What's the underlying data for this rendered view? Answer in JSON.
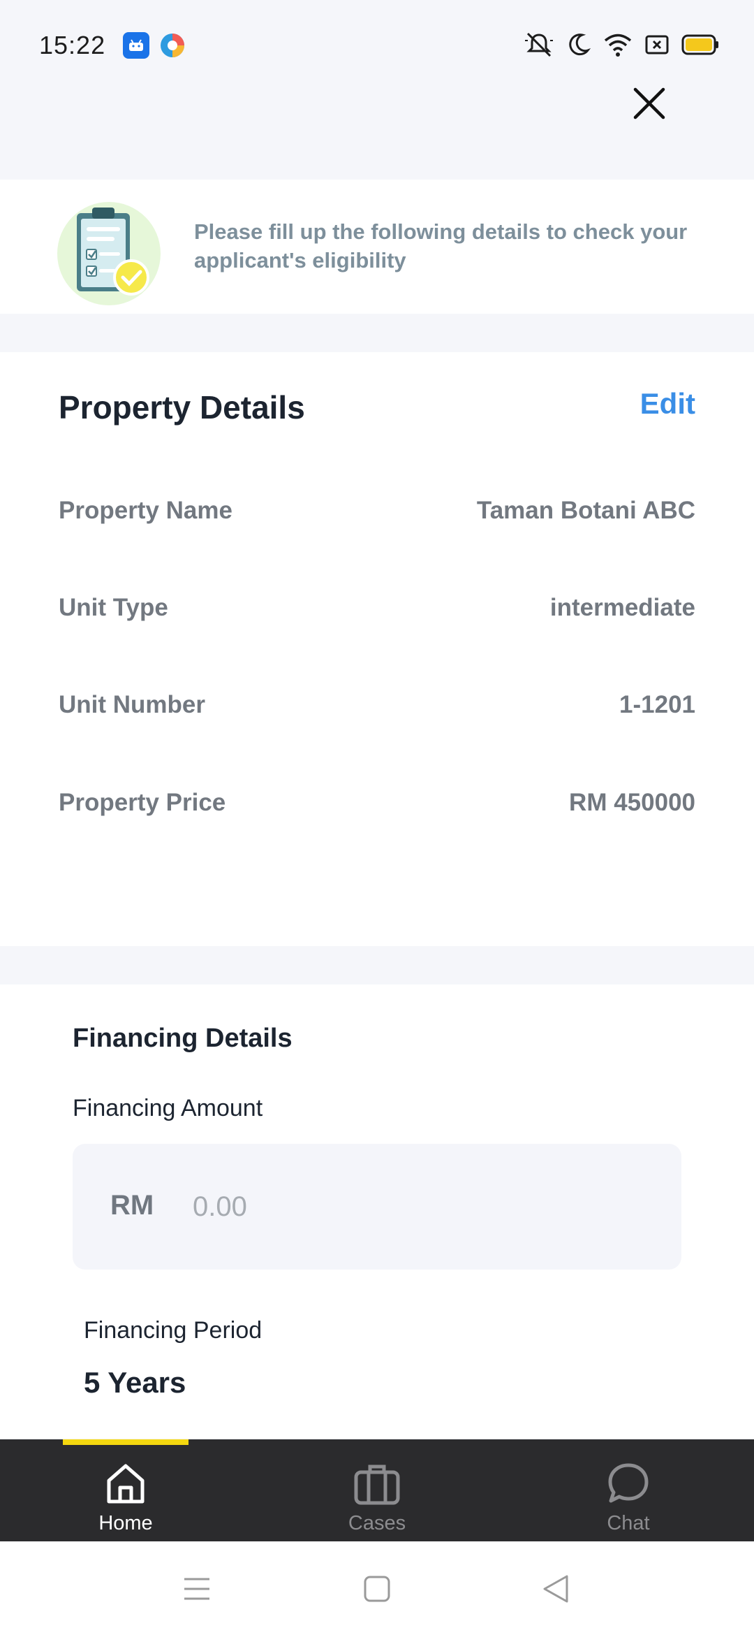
{
  "status_bar": {
    "time": "15:22"
  },
  "banner": {
    "text": "Please fill up the following details to check your applicant's eligibility"
  },
  "property_details": {
    "title": "Property Details",
    "edit_label": "Edit",
    "rows": [
      {
        "label": "Property Name",
        "value": "Taman Botani ABC"
      },
      {
        "label": "Unit Type",
        "value": "intermediate"
      },
      {
        "label": "Unit Number",
        "value": "1-1201"
      },
      {
        "label": "Property Price",
        "value": "RM 450000"
      }
    ]
  },
  "financing_details": {
    "title": "Financing Details",
    "amount_label": "Financing Amount",
    "amount_prefix": "RM",
    "amount_value": "",
    "amount_placeholder": "0.00",
    "period_label": "Financing Period",
    "period_value": "5 Years"
  },
  "tabs": [
    {
      "label": "Home",
      "icon": "home-icon",
      "active": true
    },
    {
      "label": "Cases",
      "icon": "briefcase-icon",
      "active": false
    },
    {
      "label": "Chat",
      "icon": "chat-bubble-icon",
      "active": false
    }
  ],
  "colors": {
    "accent": "#3a8ee6",
    "tab_indicator": "#f4d70f",
    "tab_bar_bg": "#2b2b2d",
    "tab_active": "#ffffff",
    "tab_inactive": "#8c8c8f"
  }
}
